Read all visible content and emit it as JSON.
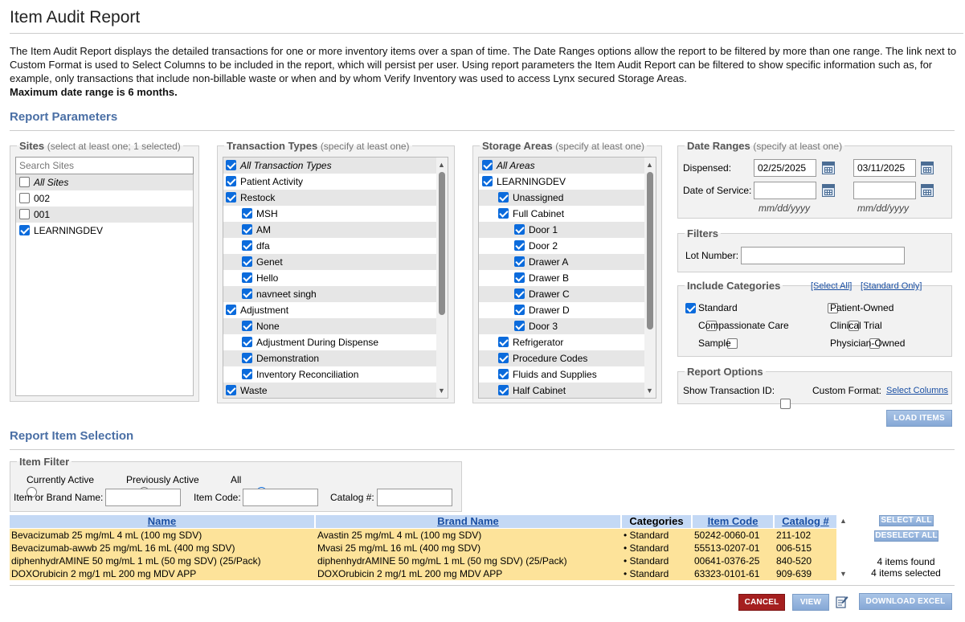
{
  "page": {
    "title": "Item Audit Report",
    "description": "The Item Audit Report displays the detailed transactions for one or more inventory items over a span of time. The Date Ranges options allow the report to be filtered by more than one range. The link next to Custom Format is used to Select Columns to be included in the report, which will persist per user. Using report parameters the Item Audit Report can be filtered to show specific information such as, for example, only transactions that include non-billable waste or when and by whom Verify Inventory was used to access Lynx secured Storage Areas.",
    "max_range": "Maximum date range is 6 months."
  },
  "report_parameters": {
    "title": "Report Parameters"
  },
  "sites": {
    "legend": "Sites",
    "hint": "(select at least one; 1 selected)",
    "search_placeholder": "Search Sites",
    "items": [
      {
        "label": "All Sites",
        "checked": false,
        "italic": true
      },
      {
        "label": "002",
        "checked": false
      },
      {
        "label": "001",
        "checked": false
      },
      {
        "label": "LEARNINGDEV",
        "checked": true
      }
    ]
  },
  "transaction_types": {
    "legend": "Transaction Types",
    "hint": "(specify at least one)",
    "items": [
      {
        "label": "All Transaction Types",
        "checked": true,
        "italic": true,
        "indent": 0
      },
      {
        "label": "Patient Activity",
        "checked": true,
        "indent": 0
      },
      {
        "label": "Restock",
        "checked": true,
        "indent": 0
      },
      {
        "label": "MSH",
        "checked": true,
        "indent": 1
      },
      {
        "label": "AM",
        "checked": true,
        "indent": 1
      },
      {
        "label": "dfa",
        "checked": true,
        "indent": 1
      },
      {
        "label": "Genet",
        "checked": true,
        "indent": 1
      },
      {
        "label": "Hello",
        "checked": true,
        "indent": 1
      },
      {
        "label": "navneet singh",
        "checked": true,
        "indent": 1
      },
      {
        "label": "Adjustment",
        "checked": true,
        "indent": 0
      },
      {
        "label": "None",
        "checked": true,
        "indent": 1
      },
      {
        "label": "Adjustment During Dispense",
        "checked": true,
        "indent": 1
      },
      {
        "label": "Demonstration",
        "checked": true,
        "indent": 1
      },
      {
        "label": "Inventory Reconciliation",
        "checked": true,
        "indent": 1
      },
      {
        "label": "Waste",
        "checked": true,
        "indent": 0
      }
    ]
  },
  "storage_areas": {
    "legend": "Storage Areas",
    "hint": "(specify at least one)",
    "items": [
      {
        "label": "All Areas",
        "checked": true,
        "italic": true,
        "indent": 0
      },
      {
        "label": "LEARNINGDEV",
        "checked": true,
        "indent": 0
      },
      {
        "label": "Unassigned",
        "checked": true,
        "indent": 1
      },
      {
        "label": "Full Cabinet",
        "checked": true,
        "indent": 1
      },
      {
        "label": "Door 1",
        "checked": true,
        "indent": 2
      },
      {
        "label": "Door 2",
        "checked": true,
        "indent": 2
      },
      {
        "label": "Drawer A",
        "checked": true,
        "indent": 2
      },
      {
        "label": "Drawer B",
        "checked": true,
        "indent": 2
      },
      {
        "label": "Drawer C",
        "checked": true,
        "indent": 2
      },
      {
        "label": "Drawer D",
        "checked": true,
        "indent": 2
      },
      {
        "label": "Door 3",
        "checked": true,
        "indent": 2
      },
      {
        "label": "Refrigerator",
        "checked": true,
        "indent": 1
      },
      {
        "label": "Procedure Codes",
        "checked": true,
        "indent": 1
      },
      {
        "label": "Fluids and Supplies",
        "checked": true,
        "indent": 1
      },
      {
        "label": "Half Cabinet",
        "checked": true,
        "indent": 1
      }
    ]
  },
  "date_ranges": {
    "legend": "Date Ranges",
    "hint": "(specify at least one)",
    "dispensed_label": "Dispensed:",
    "dispensed_from": "02/25/2025",
    "dispensed_to": "03/11/2025",
    "service_label": "Date of Service:",
    "service_from": "",
    "service_to": "",
    "format_hint": "mm/dd/yyyy"
  },
  "filters": {
    "legend": "Filters",
    "lot_label": "Lot Number:",
    "lot_value": ""
  },
  "categories": {
    "legend": "Include Categories",
    "select_all": "[Select All]",
    "standard_only": "[Standard Only]",
    "items": [
      {
        "label": "Standard",
        "checked": true
      },
      {
        "label": "Patient-Owned",
        "checked": false
      },
      {
        "label": "Compassionate Care",
        "checked": false
      },
      {
        "label": "Clinical Trial",
        "checked": false
      },
      {
        "label": "Sample",
        "checked": false
      },
      {
        "label": "Physician-Owned",
        "checked": false
      }
    ]
  },
  "report_options": {
    "legend": "Report Options",
    "show_tx_label": "Show Transaction ID:",
    "show_tx_checked": false,
    "custom_format_label": "Custom Format:",
    "select_columns": "Select Columns"
  },
  "load_items": "LOAD ITEMS",
  "item_selection": {
    "title": "Report Item Selection"
  },
  "item_filter": {
    "legend": "Item Filter",
    "radios": [
      {
        "label": "Currently Active",
        "checked": false
      },
      {
        "label": "Previously Active",
        "checked": false
      },
      {
        "label": "All",
        "checked": true
      }
    ],
    "name_label": "Item or Brand Name:",
    "code_label": "Item Code:",
    "catalog_label": "Catalog #:",
    "name_value": "",
    "code_value": "",
    "catalog_value": ""
  },
  "table": {
    "headers": [
      "Name",
      "Brand Name",
      "Categories",
      "Item Code",
      "Catalog #"
    ],
    "rows": [
      [
        "Bevacizumab 25 mg/mL 4 mL (100 mg SDV)",
        "Avastin 25 mg/mL 4 mL (100 mg SDV)",
        "• Standard",
        "50242-0060-01",
        "211-102"
      ],
      [
        "Bevacizumab-awwb 25 mg/mL 16 mL (400 mg SDV)",
        "Mvasi 25 mg/mL 16 mL (400 mg SDV)",
        "• Standard",
        "55513-0207-01",
        "006-515"
      ],
      [
        "diphenhydrAMINE 50 mg/mL 1 mL (50 mg SDV) (25/Pack)",
        "diphenhydrAMINE 50 mg/mL 1 mL (50 mg SDV) (25/Pack)",
        "• Standard",
        "00641-0376-25",
        "840-520"
      ],
      [
        "DOXOrubicin 2 mg/1 mL 200 mg MDV APP",
        "DOXOrubicin 2 mg/1 mL 200 mg MDV APP",
        "• Standard",
        "63323-0101-61",
        "909-639"
      ]
    ],
    "row_color": "#fde39a",
    "header_color": "#c4d9f5"
  },
  "side_actions": {
    "select_all": "SELECT ALL",
    "deselect_all": "DESELECT ALL",
    "found": "4 items found",
    "selected": "4 items selected"
  },
  "footer": {
    "cancel": "CANCEL",
    "view": "VIEW",
    "download": "DOWNLOAD EXCEL"
  },
  "colors": {
    "accent": "#4a6fa5",
    "checkbox": "#0b6bdc",
    "cancel": "#a51f1f",
    "button": "#94b3dc"
  }
}
